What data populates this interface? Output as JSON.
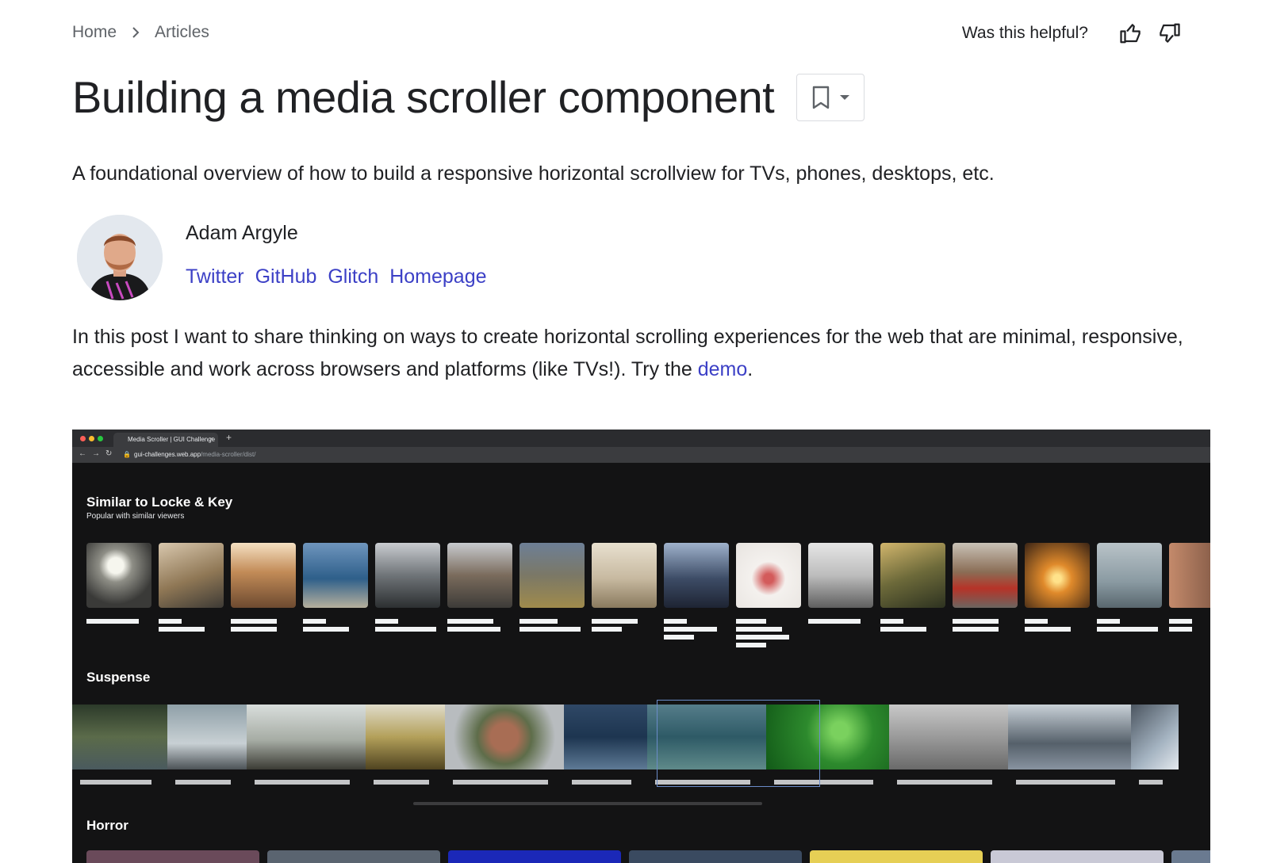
{
  "breadcrumb": {
    "home": "Home",
    "articles": "Articles"
  },
  "feedback": {
    "question": "Was this helpful?"
  },
  "article": {
    "title": "Building a media scroller component",
    "description": "A foundational overview of how to build a responsive horizontal scrollview for TVs, phones, desktops, etc.",
    "intro_text": "In this post I want to share thinking on ways to create horizontal scrolling experiences for the web that are minimal, responsive, accessible and work across browsers and platforms (like TVs!). Try the ",
    "intro_link": "demo",
    "intro_end": "."
  },
  "author": {
    "name": "Adam Argyle",
    "links": [
      "Twitter",
      "GitHub",
      "Glitch",
      "Homepage"
    ]
  },
  "demo": {
    "tab_title": "Media Scroller | GUI Challenge",
    "url_host": "gui-challenges.web.app",
    "url_path": "/media-scroller/dist/",
    "rows": [
      {
        "title": "Similar to Locke & Key",
        "subtitle": "Popular with similar viewers"
      },
      {
        "title": "Suspense"
      },
      {
        "title": "Horror"
      }
    ]
  },
  "colors": {
    "link": "#3c40c6",
    "text": "#202124",
    "muted": "#5f6368",
    "demo_bg": "#131314"
  }
}
